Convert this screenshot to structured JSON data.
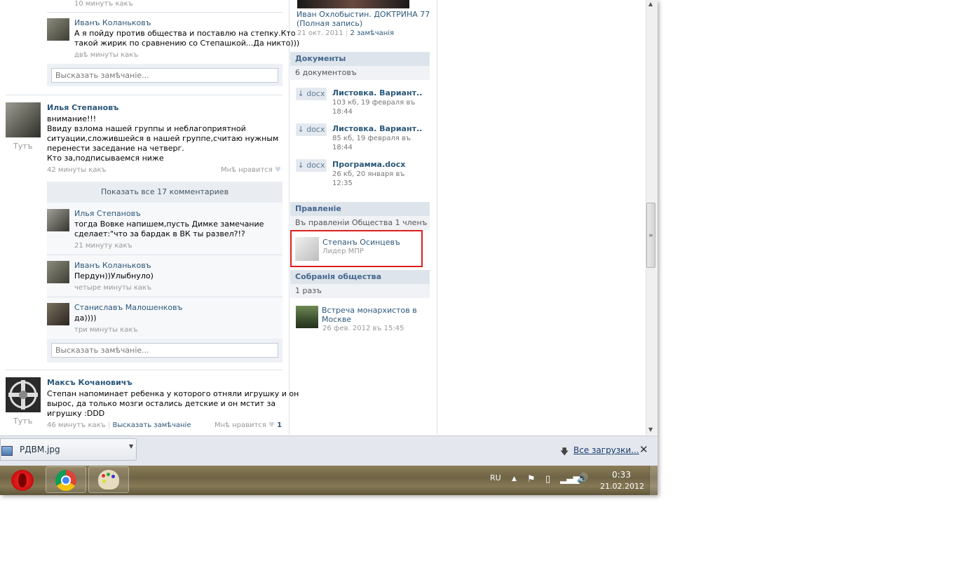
{
  "feed": {
    "top_time": "10 минутъ какъ",
    "c1": {
      "author": "Иванъ Коланьковъ",
      "text1": "А я пойду против общества и поставлю на степку.Кто",
      "text2": "такой жирик по сравнению со Степашкой...Да никто)))",
      "time": "двѣ минуты какъ"
    },
    "comment_placeholder": "Высказать замѣчаніе...",
    "post2": {
      "author": "Илья Степановъ",
      "here": "Тутъ",
      "lines": [
        "внимание!!!",
        "Ввиду взлома нашей группы и неблагоприятной",
        "ситуации,сложившейся в нашей группе,считаю нужным",
        "перенести заседание на четверг.",
        "Кто за,подписываемся ниже"
      ],
      "time": "42 минуты какъ",
      "like": "Мнѣ нравится",
      "show_all": "Показать все 17 комментариев",
      "comments": [
        {
          "author": "Илья Степановъ",
          "text1": "тогда Вовке напишем,пусть Димке замечание",
          "text2": "сделает:\"что за бардак в ВК ты развел?!?",
          "time": "21 минуту какъ"
        },
        {
          "author": "Иванъ Коланьковъ",
          "text1": "Пердун))Улыбнуло)",
          "text2": "",
          "time": "четыре минуты какъ"
        },
        {
          "author": "Станиславъ Малошенковъ",
          "text1": "да))))",
          "text2": "",
          "time": "три минуты какъ"
        }
      ]
    },
    "post3": {
      "author": "Максъ Кочановичъ",
      "here": "Тутъ",
      "lines": [
        "Степан напоминает ребенка у которого отняли игрушку и он",
        "вырос, да только мозги остались детские и он мстит за",
        "игрушку :DDD"
      ],
      "time": "46 минутъ какъ",
      "comment_link": "Высказать замѣчаніе",
      "like": "Мнѣ нравится",
      "like_count": "1"
    }
  },
  "sidebar": {
    "video": {
      "title1": "Иван Охлобыстин. ДОКТРИНА 77",
      "title2": "(Полная запись)",
      "date": "21 окт. 2011",
      "comments": "2 замѣчанія"
    },
    "docs": {
      "header": "Документы",
      "count": "6 документовъ",
      "items": [
        {
          "ext": "↓ docx",
          "title": "Листовка. Вариант..",
          "meta1": "103 кб, 19 февраля въ",
          "meta2": "18:44"
        },
        {
          "ext": "↓ docx",
          "title": "Листовка. Вариант..",
          "meta1": "85 кб, 19 февраля въ",
          "meta2": "18:44"
        },
        {
          "ext": "↓ docx",
          "title": "Программа.docx",
          "meta1": "26 кб, 20 января въ",
          "meta2": "12:35"
        }
      ]
    },
    "board": {
      "header": "Правленіе",
      "count": "Въ правленіи Общества 1 членъ",
      "member_name": "Степанъ Осинцевъ",
      "member_role": "Лидер МПР"
    },
    "events": {
      "header": "Собранія общества",
      "count": "1 разъ",
      "title1": "Встреча монархистов в",
      "title2": "Москве",
      "date": "26 фев. 2012 въ 15:45"
    }
  },
  "downloads": {
    "file": "РДВМ.jpg",
    "all": "Все загрузки..."
  },
  "taskbar": {
    "lang": "RU",
    "time": "0:33",
    "date": "21.02.2012"
  },
  "colors": {
    "highlight": "#dd1f1f",
    "link": "#2b587a",
    "section_header": "#45688e"
  }
}
